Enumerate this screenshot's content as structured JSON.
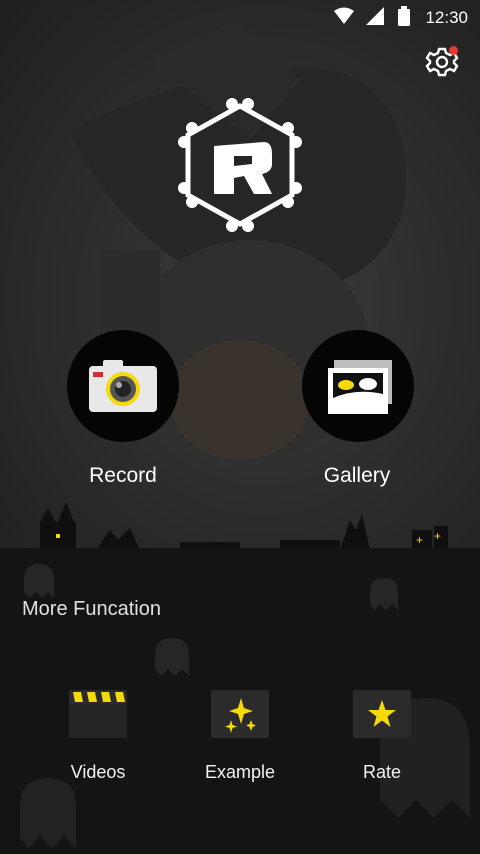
{
  "status": {
    "time": "12:30"
  },
  "main": {
    "record_label": "Record",
    "gallery_label": "Gallery"
  },
  "more": {
    "title": "More Funcation",
    "items": [
      {
        "label": "Videos",
        "icon": "clapperboard-icon"
      },
      {
        "label": "Example",
        "icon": "sparkles-icon"
      },
      {
        "label": "Rate",
        "icon": "star-icon"
      }
    ]
  },
  "colors": {
    "accent": "#f5d90a",
    "notification": "#e53935"
  }
}
